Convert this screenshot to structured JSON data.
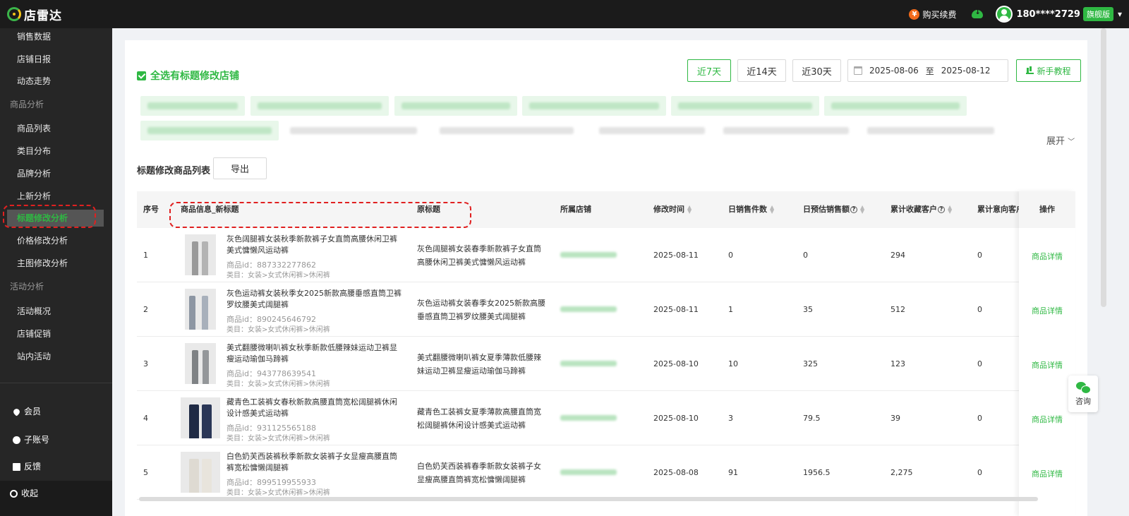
{
  "app": {
    "title": "店雷达"
  },
  "topbar": {
    "buy_label": "购买续费",
    "coin_glyph": "¥",
    "phone": "180****2729",
    "vip_badge": "旗舰版"
  },
  "sidebar": {
    "items": [
      {
        "label": "销售数据",
        "kind": "item"
      },
      {
        "label": "店铺日报",
        "kind": "item"
      },
      {
        "label": "动态走势",
        "kind": "item"
      },
      {
        "label": "商品分析",
        "kind": "group"
      },
      {
        "label": "商品列表",
        "kind": "item"
      },
      {
        "label": "类目分布",
        "kind": "item"
      },
      {
        "label": "品牌分析",
        "kind": "item"
      },
      {
        "label": "上新分析",
        "kind": "item"
      },
      {
        "label": "标题修改分析",
        "kind": "item",
        "active": true
      },
      {
        "label": "价格修改分析",
        "kind": "item"
      },
      {
        "label": "主图修改分析",
        "kind": "item"
      },
      {
        "label": "活动分析",
        "kind": "group"
      },
      {
        "label": "活动概况",
        "kind": "item"
      },
      {
        "label": "店铺促销",
        "kind": "item"
      },
      {
        "label": "站内活动",
        "kind": "item"
      }
    ],
    "bottom": [
      {
        "label": "会员",
        "icon": "diamond-icon"
      },
      {
        "label": "子账号",
        "icon": "users-icon"
      },
      {
        "label": "反馈",
        "icon": "feedback-icon"
      },
      {
        "label": "收起",
        "icon": "collapse-icon"
      }
    ]
  },
  "filter": {
    "select_all_label": "全选有标题修改店铺",
    "ranges": [
      "近7天",
      "近14天",
      "近30天"
    ],
    "active_range": "近7天",
    "date_start": "2025-08-06",
    "date_sep": "至",
    "date_end": "2025-08-12",
    "guide_label": "新手教程",
    "expand_label": "展开",
    "expand_glyph": "﹀"
  },
  "list": {
    "title": "标题修改商品列表",
    "export_label": "导出",
    "columns": [
      "序号",
      "商品信息_新标题",
      "原标题",
      "所属店铺",
      "修改时间",
      "日销售件数",
      "日预估销售额",
      "累计收藏客户",
      "累计意向客户",
      "操作"
    ],
    "rows": [
      {
        "index": "1",
        "new_title": "灰色阔腿裤女装秋季新款裤子女直筒高腰休闲卫裤美式慵懒风运动裤",
        "product_id": "商品id：887332277862",
        "category": "类目：女装>女式休闲裤>休闲裤",
        "orig_title": "灰色阔腿裤女装春季新款裤子女直筒高腰休闲卫裤美式慵懒风运动裤",
        "date": "2025-08-11",
        "daily_units": "0",
        "daily_sales": "0",
        "favorites": "294",
        "intent": "0",
        "action": "商品详情"
      },
      {
        "index": "2",
        "new_title": "灰色运动裤女装秋季女2025新款高腰垂感直筒卫裤罗纹腰美式阔腿裤",
        "product_id": "商品id：890245646792",
        "category": "类目：女装>女式休闲裤>休闲裤",
        "orig_title": "灰色运动裤女装春季女2025新款高腰垂感直筒卫裤罗纹腰美式阔腿裤",
        "date": "2025-08-11",
        "daily_units": "1",
        "daily_sales": "35",
        "favorites": "512",
        "intent": "0",
        "action": "商品详情"
      },
      {
        "index": "3",
        "new_title": "美式翻腰微喇叭裤女秋季新款低腰辣妹运动卫裤显瘦运动瑜伽马蹄裤",
        "product_id": "商品id：943778639541",
        "category": "类目：女装>女式休闲裤>休闲裤",
        "orig_title": "美式翻腰微喇叭裤女夏季薄款低腰辣妹运动卫裤显瘦运动瑜伽马蹄裤",
        "date": "2025-08-10",
        "daily_units": "10",
        "daily_sales": "325",
        "favorites": "123",
        "intent": "0",
        "action": "商品详情"
      },
      {
        "index": "4",
        "new_title": "藏青色工装裤女春秋新款高腰直筒宽松阔腿裤休闲设计感美式运动裤",
        "product_id": "商品id：931125565188",
        "category": "类目：女装>女式休闲裤>休闲裤",
        "orig_title": "藏青色工装裤女夏季薄款高腰直筒宽松阔腿裤休闲设计感美式运动裤",
        "date": "2025-08-10",
        "daily_units": "3",
        "daily_sales": "79.5",
        "favorites": "39",
        "intent": "0",
        "action": "商品详情"
      },
      {
        "index": "5",
        "new_title": "白色奶芙西装裤秋季新款女装裤子女显瘦高腰直筒裤宽松慵懒阔腿裤",
        "product_id": "商品id：899519955933",
        "category": "类目：女装>女式休闲裤>休闲裤",
        "orig_title": "白色奶芙西装裤春季新款女装裤子女显瘦高腰直筒裤宽松慵懒阔腿裤",
        "date": "2025-08-08",
        "daily_units": "91",
        "daily_sales": "1956.5",
        "favorites": "2,275",
        "intent": "0",
        "action": "商品详情"
      }
    ]
  },
  "consult": {
    "label": "咨询"
  },
  "colors": {
    "accent": "#2fb843",
    "sidebar_bg": "#262626",
    "topbar_bg": "#1b1b1b",
    "highlight": "#e02020"
  }
}
